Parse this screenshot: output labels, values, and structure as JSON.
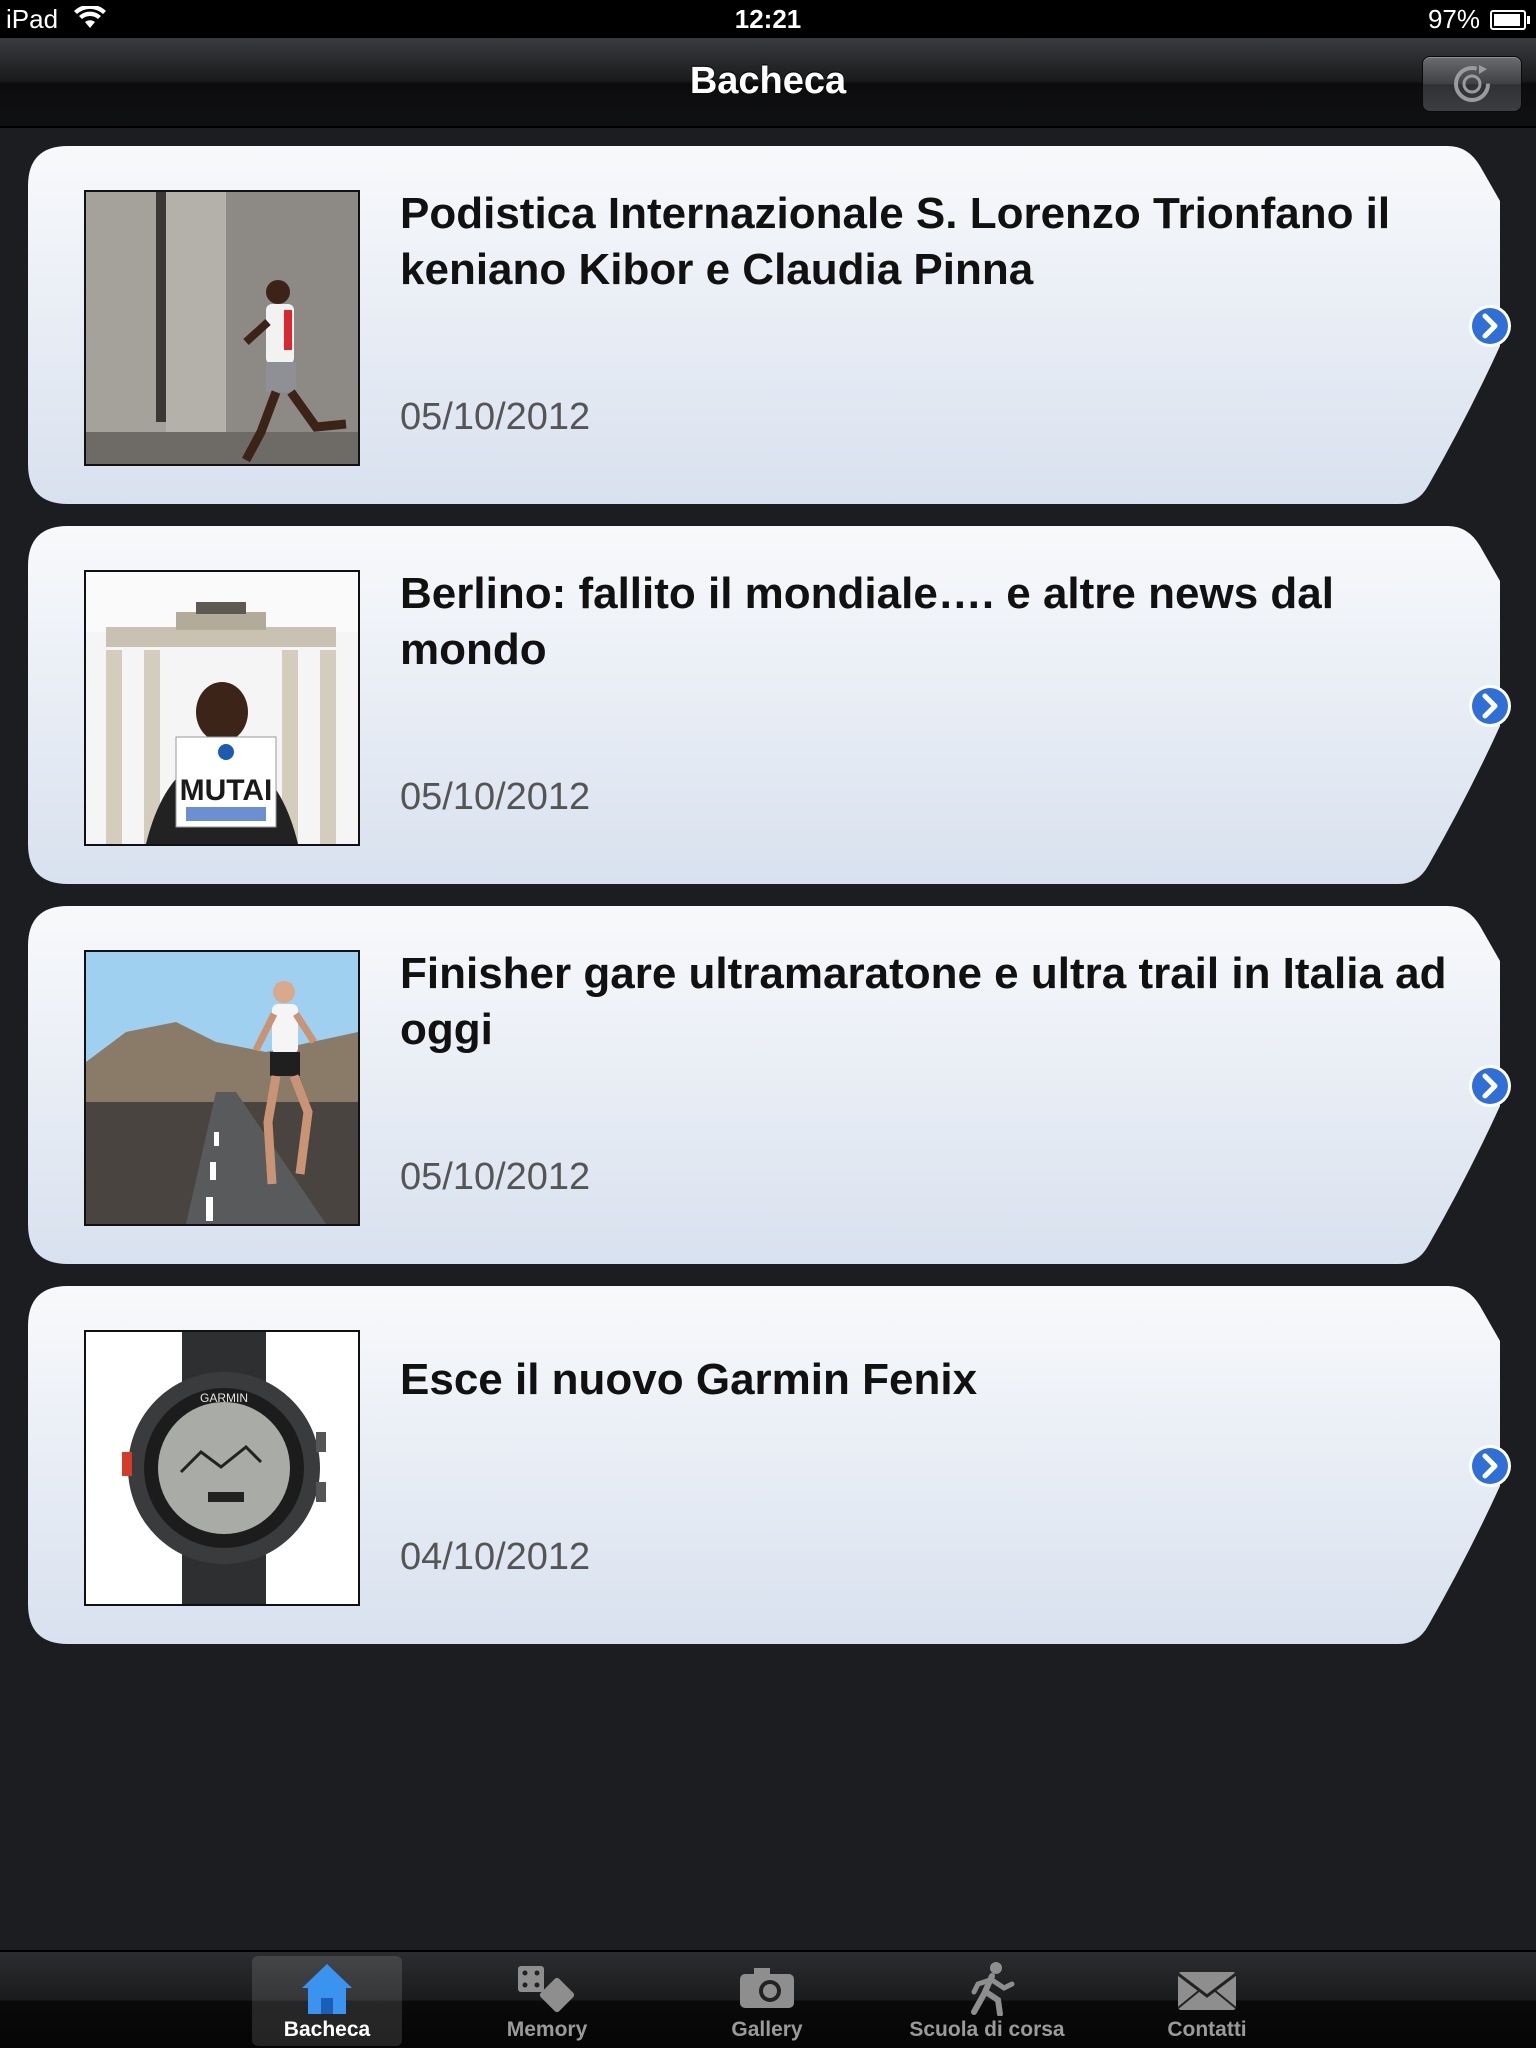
{
  "status_bar": {
    "device": "iPad",
    "time": "12:21",
    "battery": "97%"
  },
  "nav_bar": {
    "title": "Bacheca",
    "refresh_icon": "refresh-icon"
  },
  "news": [
    {
      "title": "Podistica Internazionale S. Lorenzo Trionfano il keniano Kibor e Claudia Pinna",
      "date": "05/10/2012"
    },
    {
      "title": "Berlino: fallito il mondiale…. e altre news dal mondo",
      "date": "05/10/2012",
      "photo_sign": "MUTAI"
    },
    {
      "title": "Finisher gare ultramaratone e ultra trail in Italia ad oggi",
      "date": "05/10/2012"
    },
    {
      "title": "Esce il nuovo Garmin Fenix",
      "date": "04/10/2012",
      "photo_brand": "GARMIN"
    }
  ],
  "tab_bar": {
    "tabs": [
      {
        "label": "Bacheca",
        "icon": "home-icon",
        "active": true
      },
      {
        "label": "Memory",
        "icon": "dice-icon"
      },
      {
        "label": "Gallery",
        "icon": "camera-icon"
      },
      {
        "label": "Scuola di corsa",
        "icon": "runner-icon"
      },
      {
        "label": "Contatti",
        "icon": "mail-icon"
      }
    ]
  },
  "colors": {
    "background": "#1b1d21",
    "card": "#e6ecf6",
    "disclosure": "#2f6fd6"
  }
}
